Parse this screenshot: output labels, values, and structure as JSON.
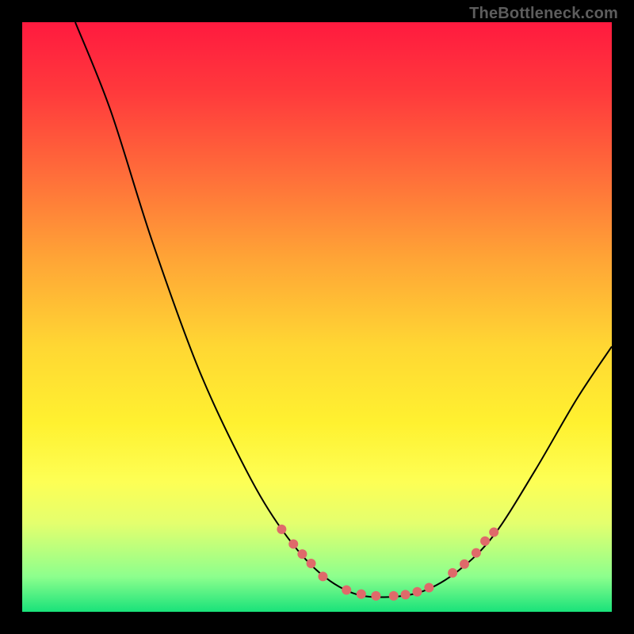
{
  "attribution": "TheBottleneck.com",
  "chart_data": {
    "type": "line",
    "title": "",
    "xlabel": "",
    "ylabel": "",
    "xlim": [
      0,
      100
    ],
    "ylim": [
      0,
      100
    ],
    "curve": [
      {
        "x": 9,
        "y": 100
      },
      {
        "x": 15,
        "y": 85
      },
      {
        "x": 22,
        "y": 63
      },
      {
        "x": 30,
        "y": 41
      },
      {
        "x": 38,
        "y": 24
      },
      {
        "x": 44,
        "y": 14
      },
      {
        "x": 50,
        "y": 7
      },
      {
        "x": 56,
        "y": 3.2
      },
      {
        "x": 62,
        "y": 2.5
      },
      {
        "x": 68,
        "y": 3.5
      },
      {
        "x": 74,
        "y": 7
      },
      {
        "x": 80,
        "y": 13
      },
      {
        "x": 87,
        "y": 24
      },
      {
        "x": 94,
        "y": 36
      },
      {
        "x": 100,
        "y": 45
      }
    ],
    "markers": [
      {
        "x": 44,
        "y": 14
      },
      {
        "x": 46,
        "y": 11.5
      },
      {
        "x": 47.5,
        "y": 9.8
      },
      {
        "x": 49,
        "y": 8.2
      },
      {
        "x": 51,
        "y": 6
      },
      {
        "x": 55,
        "y": 3.7
      },
      {
        "x": 57.5,
        "y": 3.0
      },
      {
        "x": 60,
        "y": 2.7
      },
      {
        "x": 63,
        "y": 2.7
      },
      {
        "x": 65,
        "y": 2.9
      },
      {
        "x": 67,
        "y": 3.4
      },
      {
        "x": 69,
        "y": 4.1
      },
      {
        "x": 73,
        "y": 6.6
      },
      {
        "x": 75,
        "y": 8.1
      },
      {
        "x": 77,
        "y": 10
      },
      {
        "x": 78.5,
        "y": 12
      },
      {
        "x": 80,
        "y": 13.5
      }
    ],
    "marker_radius": 6,
    "marker_color": "#df6a6a",
    "line_color": "#000000"
  }
}
